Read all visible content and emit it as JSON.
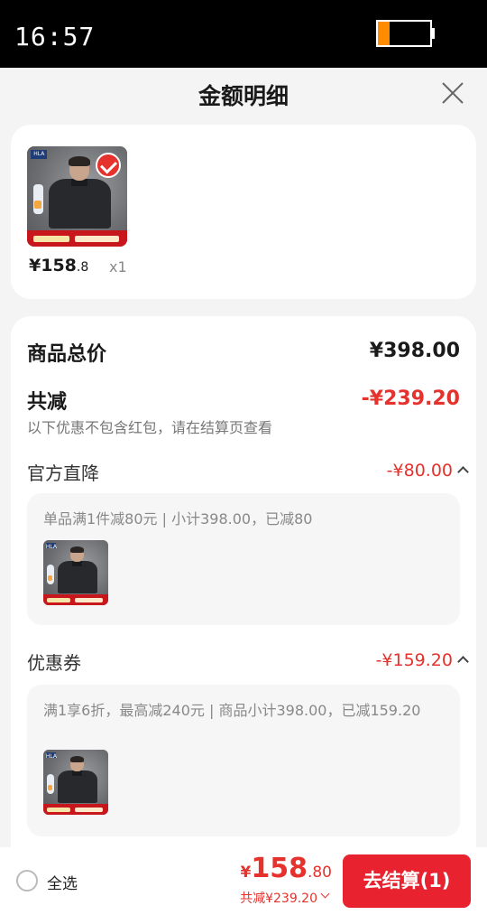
{
  "status_bar": {
    "time": "16:57",
    "battery_level": 0.22
  },
  "header": {
    "title": "金额明细",
    "close_icon": "close-icon"
  },
  "product": {
    "price_int": "¥158",
    "price_dec": ".8",
    "quantity": "x1",
    "selected": true
  },
  "summary": {
    "total_label": "商品总价",
    "total_value": "¥398.00",
    "discount_label": "共减",
    "discount_value": "-¥239.20",
    "note": "以下优惠不包含红包，请在结算页查看"
  },
  "sections": [
    {
      "label": "官方直降",
      "value": "-¥80.00",
      "detail": "单品满1件减80元 | 小计398.00，已减80"
    },
    {
      "label": "优惠券",
      "value": "-¥159.20",
      "detail": "满1享6折，最高减240元 | 商品小计398.00，已减159.20"
    }
  ],
  "bottom_bar": {
    "select_all": "全选",
    "price_yen": "¥",
    "price_int": "158",
    "price_dec": ".80",
    "discount": "共减¥239.20",
    "checkout_label": "去结算(1)"
  },
  "colors": {
    "accent": "#e5322d",
    "button": "#e8232f",
    "background": "#f4f4f4"
  }
}
